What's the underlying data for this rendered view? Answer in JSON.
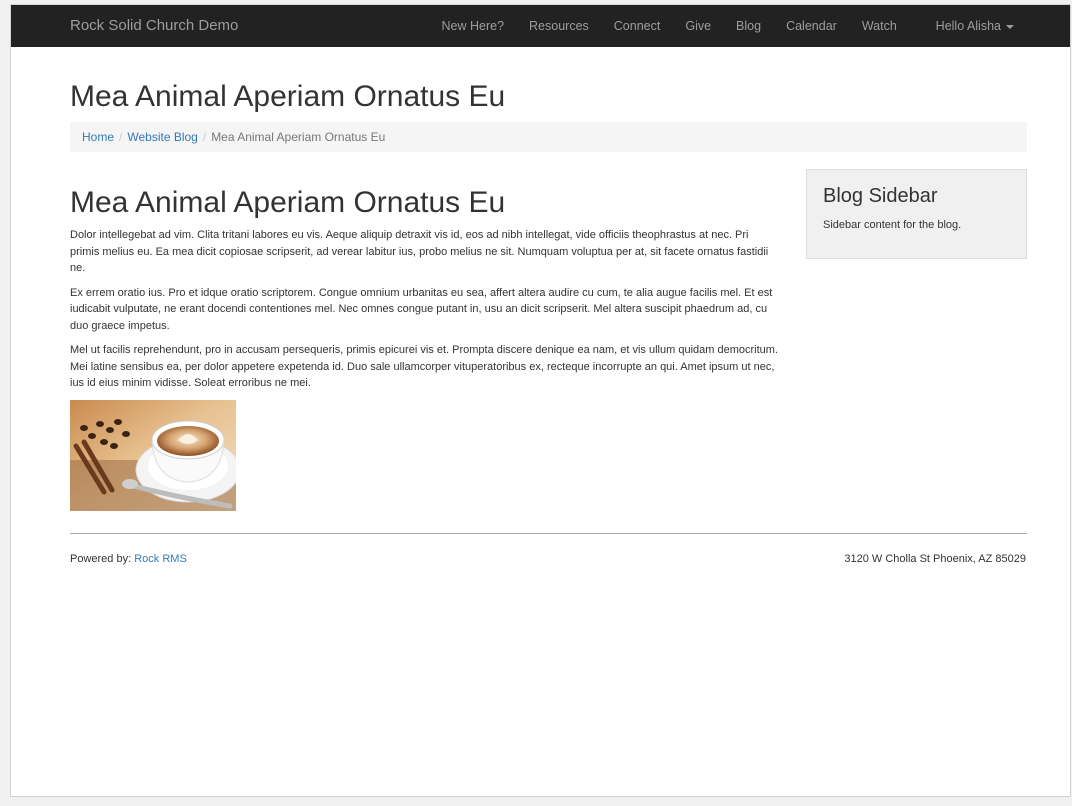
{
  "navbar": {
    "brand": "Rock Solid Church Demo",
    "items": [
      {
        "label": "New Here?"
      },
      {
        "label": "Resources"
      },
      {
        "label": "Connect"
      },
      {
        "label": "Give"
      },
      {
        "label": "Blog"
      },
      {
        "label": "Calendar"
      },
      {
        "label": "Watch"
      }
    ],
    "user_greeting": "Hello Alisha"
  },
  "page": {
    "title": "Mea Animal Aperiam Ornatus Eu"
  },
  "breadcrumb": {
    "home": "Home",
    "section": "Website Blog",
    "current": "Mea Animal Aperiam Ornatus Eu",
    "separator": "/"
  },
  "post": {
    "title": "Mea Animal Aperiam Ornatus Eu",
    "paragraphs": [
      "Dolor intellegebat ad vim. Clita tritani labores eu vis. Aeque aliquip detraxit vis id, eos ad nibh intellegat, vide officiis theophrastus at nec. Pri primis melius eu. Ea mea dicit copiosae scripserit, ad verear labitur ius, probo melius ne sit. Numquam voluptua per at, sit facete ornatus fastidii ne.",
      "Ex errem oratio ius. Pro et idque oratio scriptorem. Congue omnium urbanitas eu sea, affert altera audire cu cum, te alia augue facilis mel. Et est iudicabit vulputate, ne erant docendi contentiones mel. Nec omnes congue putant in, usu an dicit scripserit. Mel altera suscipit phaedrum ad, cu duo graece impetus.",
      "Mel ut facilis reprehendunt, pro in accusam persequeris, primis epicurei vis et. Prompta discere denique ea nam, et vis ullum quidam democritum. Mei latine sensibus ea, per dolor appetere expetenda id. Duo sale ullamcorper vituperatoribus ex, recteque incorrupte an qui. Amet ipsum ut nec, ius id eius minim vidisse. Soleat erroribus ne mei."
    ]
  },
  "sidebar": {
    "title": "Blog Sidebar",
    "content": "Sidebar content for the blog."
  },
  "footer": {
    "powered_by_label": "Powered by:",
    "powered_by_link": "Rock RMS",
    "address": "3120 W Cholla St Phoenix, AZ 85029"
  }
}
